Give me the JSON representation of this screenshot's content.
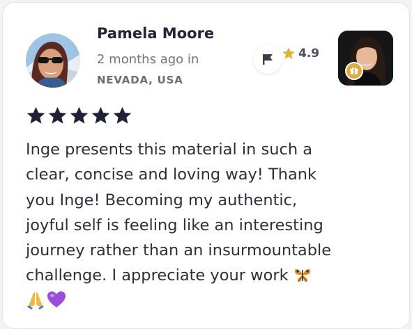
{
  "review": {
    "author_name": "Pamela Moore",
    "timestamp_text": "2 months ago in",
    "location": "NEVADA, USA",
    "rating_value": "4.9",
    "star_rating": 5,
    "body_text": "Inge presents this material in such a clear, concise and loving way! Thank you Inge! Becoming my authentic, joyful self is feeling like an interesting journey rather than an insurmountable challenge. I appreciate your work"
  },
  "icons": {
    "flag": "flag-icon",
    "rating_star": "star-icon",
    "badge": "gift-icon",
    "emojis": [
      "butterfly-emoji",
      "folded-hands-emoji",
      "purple-heart-emoji"
    ]
  },
  "colors": {
    "rating_star": "#e5b03a",
    "review_stars": "#1e2234",
    "badge": "#e3a93a",
    "heart": "#9b4dd9",
    "butterfly": "#e08a2c"
  }
}
